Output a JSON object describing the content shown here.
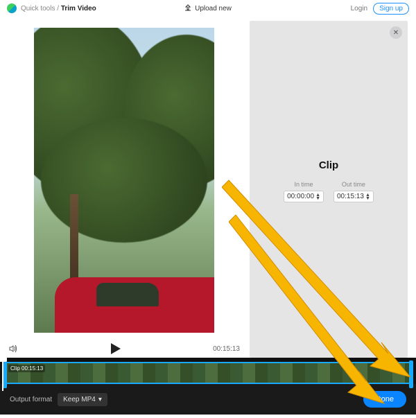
{
  "header": {
    "crumb_root": "Quick tools",
    "crumb_sep": "/",
    "crumb_current": "Trim Video",
    "upload_label": "Upload new",
    "login_label": "Login",
    "signup_label": "Sign up"
  },
  "player": {
    "current_time": "00:15:13"
  },
  "clip_panel": {
    "title": "Clip",
    "in_time": {
      "label": "In time",
      "value": "00:00:00"
    },
    "out_time": {
      "label": "Out time",
      "value": "00:15:13"
    }
  },
  "timeline": {
    "clip_label": "Clip 00:15:13"
  },
  "footer": {
    "output_label": "Output format",
    "format_value": "Keep MP4",
    "done_label": "Done"
  }
}
